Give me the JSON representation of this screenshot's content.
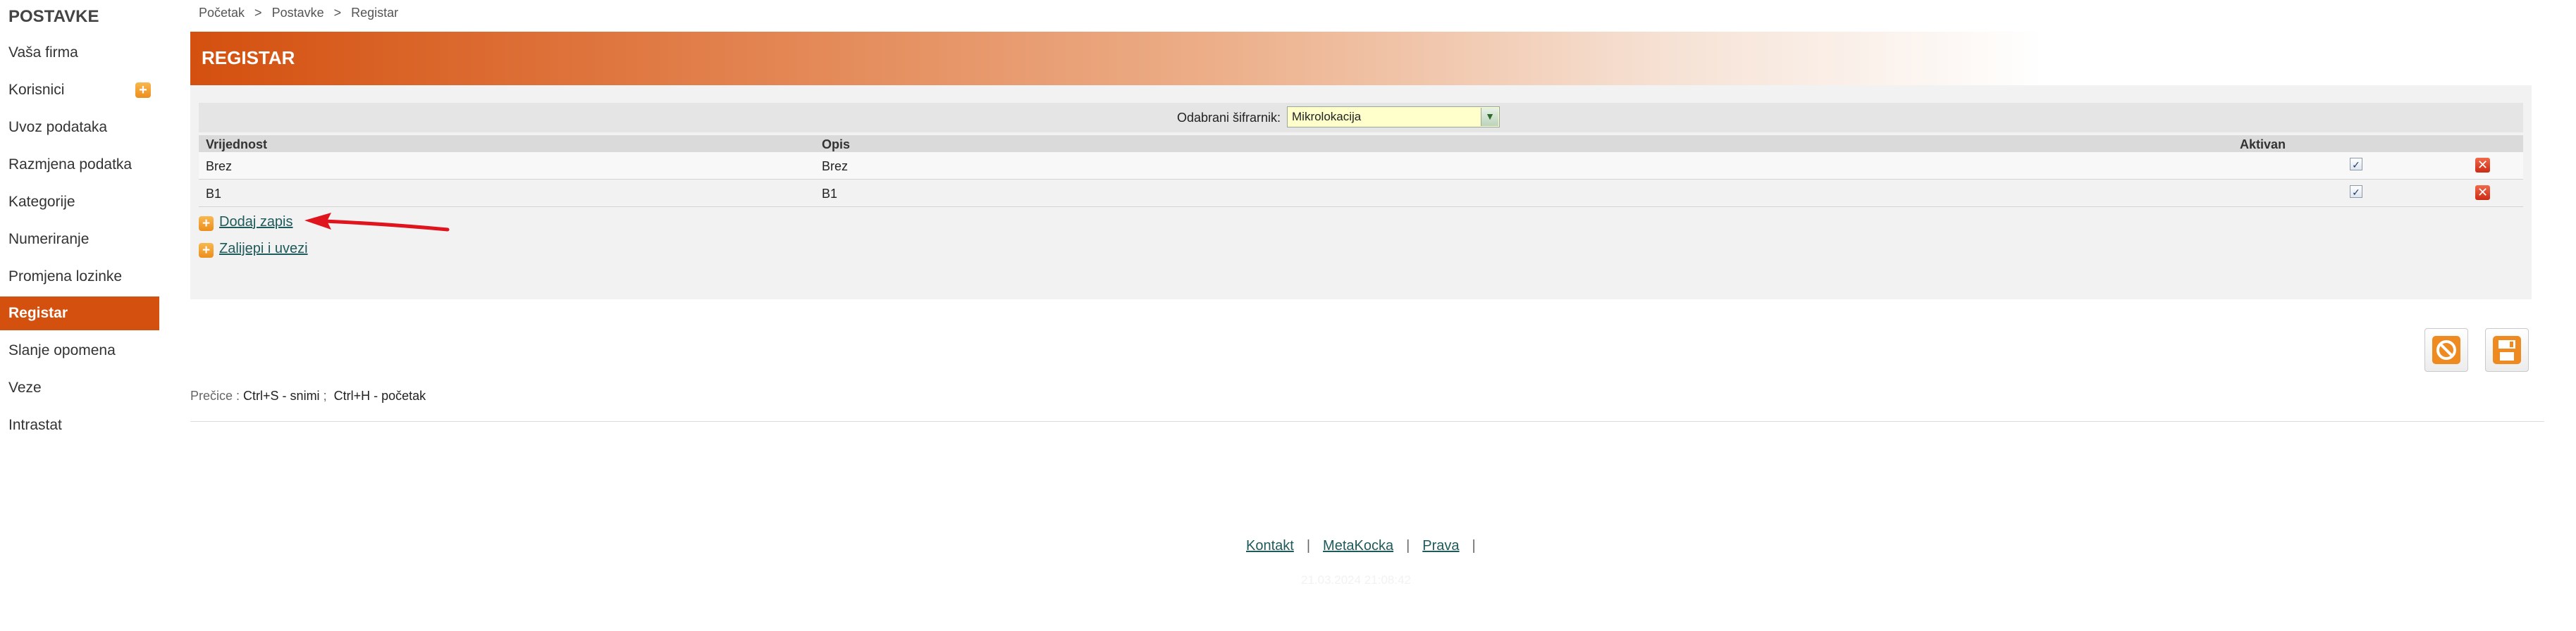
{
  "sidebar": {
    "title": "POSTAVKE",
    "items": [
      {
        "label": "Vaša firma"
      },
      {
        "label": "Korisnici"
      },
      {
        "label": "Uvoz podataka"
      },
      {
        "label": "Razmjena podatka"
      },
      {
        "label": "Kategorije"
      },
      {
        "label": "Numeriranje"
      },
      {
        "label": "Promjena lozinke"
      },
      {
        "label": "Registar"
      },
      {
        "label": "Slanje opomena"
      },
      {
        "label": "Veze"
      },
      {
        "label": "Intrastat"
      }
    ],
    "active": "Registar"
  },
  "breadcrumb": [
    "Početak",
    "Postavke",
    "Registar"
  ],
  "breadcrumb_sep": ">",
  "header": {
    "title": "REGISTAR"
  },
  "filter": {
    "label": "Odabrani šifrarnik:",
    "selected": "Mikrolokacija"
  },
  "table": {
    "columns": [
      "Vrijednost",
      "Opis",
      "Aktivan"
    ],
    "rows": [
      {
        "vrijednost": "Brez",
        "opis": "Brez",
        "aktivan": true
      },
      {
        "vrijednost": "B1",
        "opis": "B1",
        "aktivan": true
      }
    ]
  },
  "actions": {
    "add_record": "Dodaj zapis",
    "paste_import": "Zalijepi i uvezi"
  },
  "shortcuts": {
    "label": "Prečice :",
    "save": "Ctrl+S - snimi",
    "sep": ";",
    "home": "Ctrl+H - početak"
  },
  "footer": {
    "links": [
      "Kontakt",
      "MetaKocka",
      "Prava"
    ],
    "sep": "|"
  },
  "timestamp": "21.03.2024 21:08:42",
  "colors": {
    "accent": "#d4500f",
    "link": "#1e5a5a",
    "annotation_arrow": "#e0141c"
  }
}
